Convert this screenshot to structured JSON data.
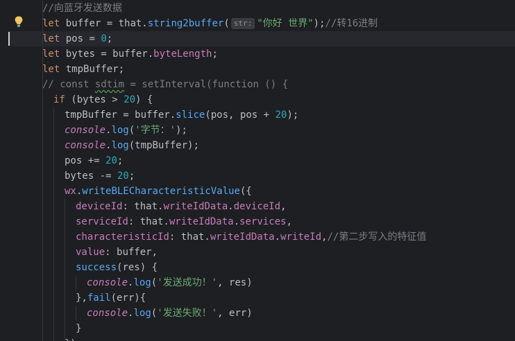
{
  "editor": {
    "lines": [
      {
        "id": "l1",
        "tokens": [
          {
            "t": "//向蓝牙发送数据",
            "c": "cmt"
          }
        ]
      },
      {
        "id": "l2",
        "tokens": [
          {
            "t": "let",
            "c": "kw"
          },
          {
            "t": " buffer = that.",
            "c": ""
          },
          {
            "t": "string2buffer",
            "c": "fn"
          },
          {
            "t": "(",
            "c": ""
          },
          {
            "hint": "str:"
          },
          {
            "t": "\"你好 世界\"",
            "c": "str"
          },
          {
            "t": ");",
            "c": ""
          },
          {
            "t": "//转16进制",
            "c": "cmt"
          }
        ]
      },
      {
        "id": "l3",
        "tokens": [
          {
            "t": "let",
            "c": "kw"
          },
          {
            "t": " pos = ",
            "c": ""
          },
          {
            "t": "0",
            "c": "num"
          },
          {
            "t": ";",
            "c": ""
          }
        ]
      },
      {
        "id": "l4",
        "tokens": [
          {
            "t": "let",
            "c": "kw"
          },
          {
            "t": " bytes = buffer.",
            "c": ""
          },
          {
            "t": "byteLength",
            "c": "prop"
          },
          {
            "t": ";",
            "c": ""
          }
        ]
      },
      {
        "id": "l5",
        "tokens": [
          {
            "t": "let",
            "c": "kw"
          },
          {
            "t": " tmpBuffer;",
            "c": ""
          }
        ]
      },
      {
        "id": "l6",
        "tokens": [
          {
            "t": "// const ",
            "c": "cmt"
          },
          {
            "t": "sdtim",
            "c": "cmt",
            "squiggle": true
          },
          {
            "t": " = setInterval(function () {",
            "c": "cmt"
          }
        ]
      },
      {
        "id": "l7",
        "tokens": [
          {
            "t": "if",
            "c": "kw"
          },
          {
            "t": " (bytes > ",
            "c": ""
          },
          {
            "t": "20",
            "c": "num"
          },
          {
            "t": ") {",
            "c": ""
          }
        ]
      },
      {
        "id": "l8",
        "tokens": [
          {
            "t": "tmpBuffer = buffer.",
            "c": ""
          },
          {
            "t": "slice",
            "c": "fn"
          },
          {
            "t": "(pos, pos + ",
            "c": ""
          },
          {
            "t": "20",
            "c": "num"
          },
          {
            "t": ");",
            "c": ""
          }
        ]
      },
      {
        "id": "l9",
        "tokens": [
          {
            "t": "console",
            "c": "it"
          },
          {
            "t": ".",
            "c": ""
          },
          {
            "t": "log",
            "c": "fn"
          },
          {
            "t": "(",
            "c": ""
          },
          {
            "t": "'字节：'",
            "c": "str"
          },
          {
            "t": ");",
            "c": ""
          }
        ]
      },
      {
        "id": "l10",
        "tokens": [
          {
            "t": "console",
            "c": "it"
          },
          {
            "t": ".",
            "c": ""
          },
          {
            "t": "log",
            "c": "fn"
          },
          {
            "t": "(tmpBuffer);",
            "c": ""
          }
        ]
      },
      {
        "id": "l11",
        "tokens": [
          {
            "t": "pos += ",
            "c": ""
          },
          {
            "t": "20",
            "c": "num"
          },
          {
            "t": ";",
            "c": ""
          }
        ]
      },
      {
        "id": "l12",
        "tokens": [
          {
            "t": "bytes -= ",
            "c": ""
          },
          {
            "t": "20",
            "c": "num"
          },
          {
            "t": ";",
            "c": ""
          }
        ]
      },
      {
        "id": "l13",
        "tokens": [
          {
            "t": "wx",
            "c": "prop"
          },
          {
            "t": ".",
            "c": ""
          },
          {
            "t": "writeBLECharacteristicValue",
            "c": "fn"
          },
          {
            "t": "({",
            "c": ""
          }
        ]
      },
      {
        "id": "l14",
        "tokens": [
          {
            "t": "deviceId",
            "c": "prop"
          },
          {
            "t": ": that.",
            "c": ""
          },
          {
            "t": "writeIdData",
            "c": "prop"
          },
          {
            "t": ".",
            "c": ""
          },
          {
            "t": "deviceId",
            "c": "prop"
          },
          {
            "t": ",",
            "c": ""
          }
        ]
      },
      {
        "id": "l15",
        "tokens": [
          {
            "t": "serviceId",
            "c": "prop"
          },
          {
            "t": ": that.",
            "c": ""
          },
          {
            "t": "writeIdData",
            "c": "prop"
          },
          {
            "t": ".",
            "c": ""
          },
          {
            "t": "services",
            "c": "prop"
          },
          {
            "t": ",",
            "c": ""
          }
        ]
      },
      {
        "id": "l16",
        "tokens": [
          {
            "t": "characteristicId",
            "c": "prop"
          },
          {
            "t": ": that.",
            "c": ""
          },
          {
            "t": "writeIdData",
            "c": "prop"
          },
          {
            "t": ".",
            "c": ""
          },
          {
            "t": "writeId",
            "c": "prop"
          },
          {
            "t": ",",
            "c": ""
          },
          {
            "t": "//第二步写入的特征值",
            "c": "cmt"
          }
        ]
      },
      {
        "id": "l17",
        "tokens": [
          {
            "t": "value",
            "c": "prop"
          },
          {
            "t": ": buffer,",
            "c": ""
          }
        ]
      },
      {
        "id": "l18",
        "tokens": [
          {
            "t": "success",
            "c": "fn"
          },
          {
            "t": "(res) {",
            "c": ""
          }
        ]
      },
      {
        "id": "l19",
        "tokens": [
          {
            "t": "console",
            "c": "it"
          },
          {
            "t": ".",
            "c": ""
          },
          {
            "t": "log",
            "c": "fn"
          },
          {
            "t": "(",
            "c": ""
          },
          {
            "t": "'发送成功！'",
            "c": "str"
          },
          {
            "t": ", res)",
            "c": ""
          }
        ]
      },
      {
        "id": "l20",
        "tokens": [
          {
            "t": "},",
            "c": ""
          },
          {
            "t": "fail",
            "c": "fn"
          },
          {
            "t": "(err){",
            "c": ""
          }
        ]
      },
      {
        "id": "l21",
        "tokens": [
          {
            "t": "console",
            "c": "it"
          },
          {
            "t": ".",
            "c": ""
          },
          {
            "t": "log",
            "c": "fn"
          },
          {
            "t": "(",
            "c": ""
          },
          {
            "t": "'发送失败！'",
            "c": "str"
          },
          {
            "t": ", err)",
            "c": ""
          }
        ]
      },
      {
        "id": "l22",
        "tokens": [
          {
            "t": "}",
            "c": ""
          }
        ]
      },
      {
        "id": "l23",
        "tokens": [
          {
            "t": "});",
            "c": ""
          }
        ]
      }
    ]
  },
  "icons": {
    "intention_bulb": "lightbulb-icon"
  },
  "colors": {
    "background": "#1e1f22",
    "current_line": "#26282e",
    "keyword": "#cf8e6d",
    "function": "#56a8f5",
    "number": "#2aacb8",
    "string": "#6aab73",
    "comment": "#7a7e85",
    "property": "#c77dbb",
    "default": "#bcbec4"
  }
}
